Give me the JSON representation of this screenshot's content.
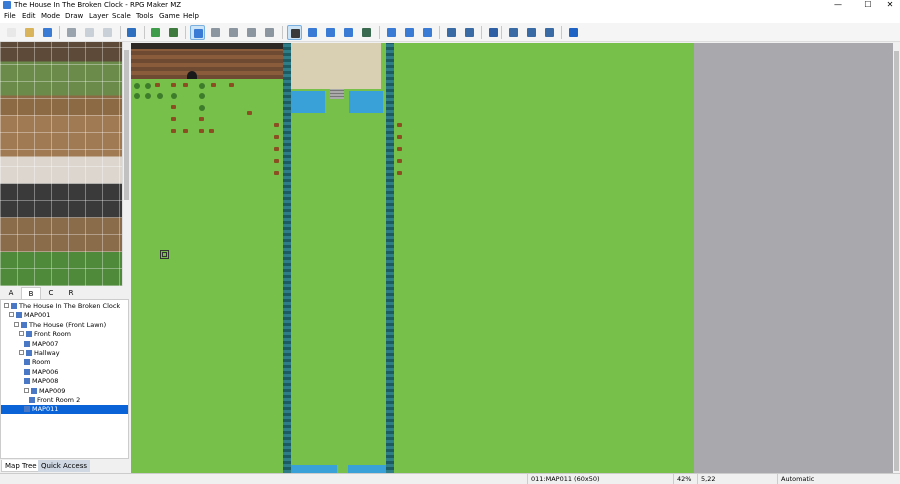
{
  "window": {
    "title": "The House In The Broken Clock - RPG Maker MZ",
    "controls": [
      "—",
      "☐",
      "✕"
    ]
  },
  "menu": [
    "File",
    "Edit",
    "Mode",
    "Draw",
    "Layer",
    "Scale",
    "Tools",
    "Game",
    "Help"
  ],
  "toolbar": {
    "buttons": [
      {
        "name": "new-project-button",
        "color": "#e8e8e8"
      },
      {
        "name": "open-project-button",
        "color": "#d9b45a"
      },
      {
        "name": "save-project-button",
        "color": "#3a7bd5"
      },
      {
        "name": "cut-button",
        "color": "#9aa4ae"
      },
      {
        "name": "copy-button",
        "color": "#c9d0d8"
      },
      {
        "name": "paste-button",
        "color": "#c9d0d8"
      },
      {
        "name": "undo-button",
        "color": "#2f6fbf"
      },
      {
        "name": "map-mode-button",
        "color": "#3f9c4a"
      },
      {
        "name": "event-mode-button",
        "color": "#3f7a3f"
      },
      {
        "name": "layer-auto-button",
        "color": "#3a7bd5"
      },
      {
        "name": "layer-1-button",
        "color": "#8c96a0"
      },
      {
        "name": "layer-2-button",
        "color": "#8c96a0"
      },
      {
        "name": "layer-3-button",
        "color": "#8c96a0"
      },
      {
        "name": "layer-4-button",
        "color": "#8c96a0"
      },
      {
        "name": "pencil-tool-button",
        "color": "#3a3a3a"
      },
      {
        "name": "rectangle-tool-button",
        "color": "#3a7bd5"
      },
      {
        "name": "ellipse-tool-button",
        "color": "#3a7bd5"
      },
      {
        "name": "fill-tool-button",
        "color": "#3a7bd5"
      },
      {
        "name": "shadow-pen-button",
        "color": "#3a6b50"
      },
      {
        "name": "zoom-in-button",
        "color": "#3a7bd5"
      },
      {
        "name": "zoom-out-button",
        "color": "#3a7bd5"
      },
      {
        "name": "zoom-actual-button",
        "color": "#3a7bd5"
      },
      {
        "name": "database-button",
        "color": "#3a6ba5"
      },
      {
        "name": "plugin-manager-button",
        "color": "#3a6ba5"
      },
      {
        "name": "sound-test-button",
        "color": "#2f5fa5"
      },
      {
        "name": "event-searcher-button",
        "color": "#3a6ba5"
      },
      {
        "name": "resource-manager-button",
        "color": "#3a6ba5"
      },
      {
        "name": "character-generator-button",
        "color": "#3a6ba5"
      },
      {
        "name": "playtest-button",
        "color": "#1f63c4"
      }
    ]
  },
  "tileset_tabs": [
    "A",
    "B",
    "C",
    "R"
  ],
  "tileset_active_tab": "B",
  "map_tree": [
    {
      "label": "The House In The Broken Clock",
      "level": 0
    },
    {
      "label": "MAP001",
      "level": 1
    },
    {
      "label": "The House (Front Lawn)",
      "level": 2
    },
    {
      "label": "Front Room",
      "level": 3
    },
    {
      "label": "MAP007",
      "level": 4
    },
    {
      "label": "Hallway",
      "level": 3
    },
    {
      "label": "Room",
      "level": 4
    },
    {
      "label": "MAP006",
      "level": 4
    },
    {
      "label": "MAP008",
      "level": 4
    },
    {
      "label": "MAP009",
      "level": 4
    },
    {
      "label": "Front Room 2",
      "level": 5
    },
    {
      "label": "MAP011",
      "level": 4,
      "selected": true
    }
  ],
  "bottom_tabs": [
    "Map Tree",
    "Quick Access"
  ],
  "status": {
    "map": "011:MAP011 (60x50)",
    "zoom": "42%",
    "coords": "5,22",
    "mode": "Automatic"
  }
}
